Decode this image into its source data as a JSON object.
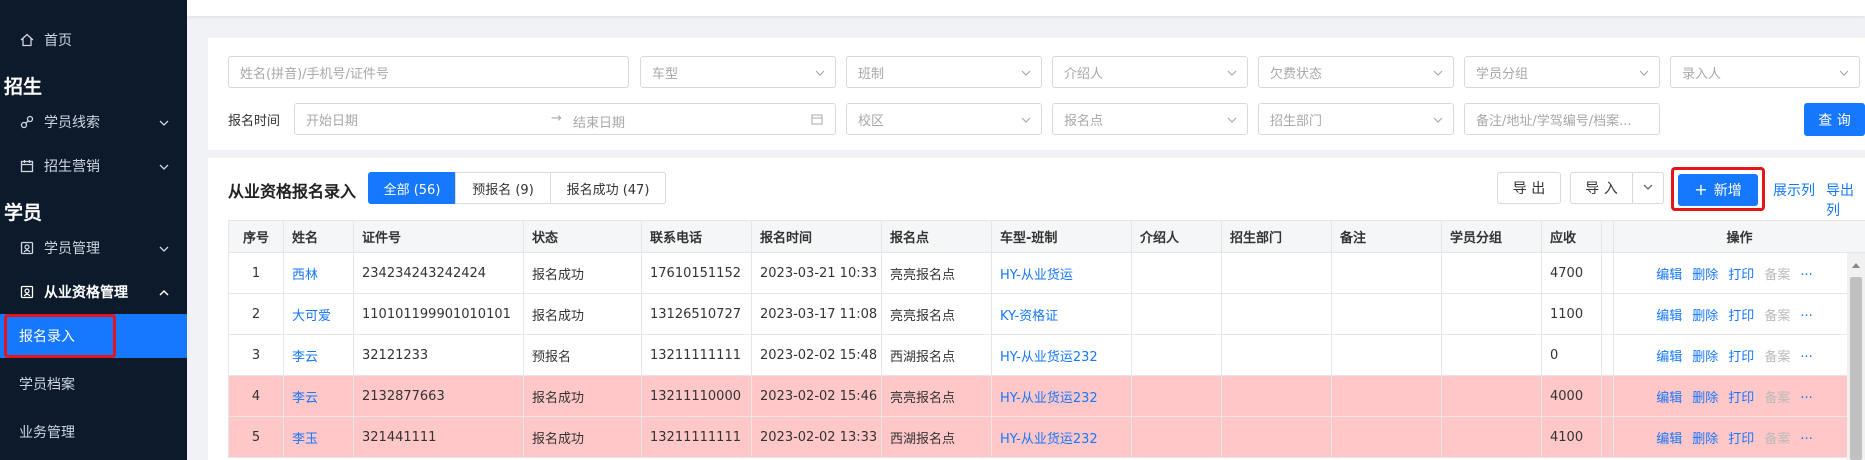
{
  "sidebar": {
    "home": "首页",
    "section_recruit": "招生",
    "student_leads": "学员线索",
    "recruit_marketing": "招生营销",
    "section_student": "学员",
    "student_manage": "学员管理",
    "qualification_manage": "从业资格管理",
    "signup_entry": "报名录入",
    "student_archive": "学员档案",
    "business_manage": "业务管理"
  },
  "filters": {
    "name_placeholder": "姓名(拼音)/手机号/证件号",
    "car_type": "车型",
    "class_system": "班制",
    "introducer": "介绍人",
    "fee_status": "欠费状态",
    "student_group": "学员分组",
    "entry_person": "录入人",
    "signup_time_label": "报名时间",
    "start_date": "开始日期",
    "end_date": "结束日期",
    "campus": "校区",
    "signup_point": "报名点",
    "recruit_dept": "招生部门",
    "remark_placeholder": "备注/地址/学驾编号/档案...",
    "query_button": "查 询"
  },
  "toolbar": {
    "title": "从业资格报名录入",
    "tab_all": "全部 (56)",
    "tab_pre": "预报名 (9)",
    "tab_success": "报名成功 (47)",
    "export": "导 出",
    "import": "导 入",
    "add": "新增",
    "show_columns": "展示列",
    "export_columns": "导出列"
  },
  "table": {
    "headers": [
      "序号",
      "姓名",
      "证件号",
      "状态",
      "联系电话",
      "报名时间",
      "报名点",
      "车型-班制",
      "介绍人",
      "招生部门",
      "备注",
      "学员分组",
      "应收",
      "",
      "操作"
    ],
    "ops": [
      "编辑",
      "删除",
      "打印",
      "备案",
      "···"
    ],
    "rows": [
      {
        "no": "1",
        "name": "西林",
        "id": "234234243242424",
        "status": "报名成功",
        "phone": "17610151152",
        "time": "2023-03-21 10:33",
        "point": "亮亮报名点",
        "car": "HY-从业货运",
        "due": "4700",
        "highlight": false
      },
      {
        "no": "2",
        "name": "大可爱",
        "id": "110101199901010101",
        "status": "报名成功",
        "phone": "13126510727",
        "time": "2023-03-17 11:08",
        "point": "亮亮报名点",
        "car": "KY-资格证",
        "due": "1100",
        "highlight": false
      },
      {
        "no": "3",
        "name": "李云",
        "id": "32121233",
        "status": "预报名",
        "phone": "13211111111",
        "time": "2023-02-02 15:48",
        "point": "西湖报名点",
        "car": "HY-从业货运232",
        "due": "0",
        "highlight": false
      },
      {
        "no": "4",
        "name": "李云",
        "id": "2132877663",
        "status": "报名成功",
        "phone": "13211110000",
        "time": "2023-02-02 15:46",
        "point": "亮亮报名点",
        "car": "HY-从业货运232",
        "due": "4000",
        "highlight": true
      },
      {
        "no": "5",
        "name": "李玉",
        "id": "321441111",
        "status": "报名成功",
        "phone": "13211111111",
        "time": "2023-02-02 13:33",
        "point": "西湖报名点",
        "car": "HY-从业货运232",
        "due": "4100",
        "highlight": true
      }
    ]
  }
}
